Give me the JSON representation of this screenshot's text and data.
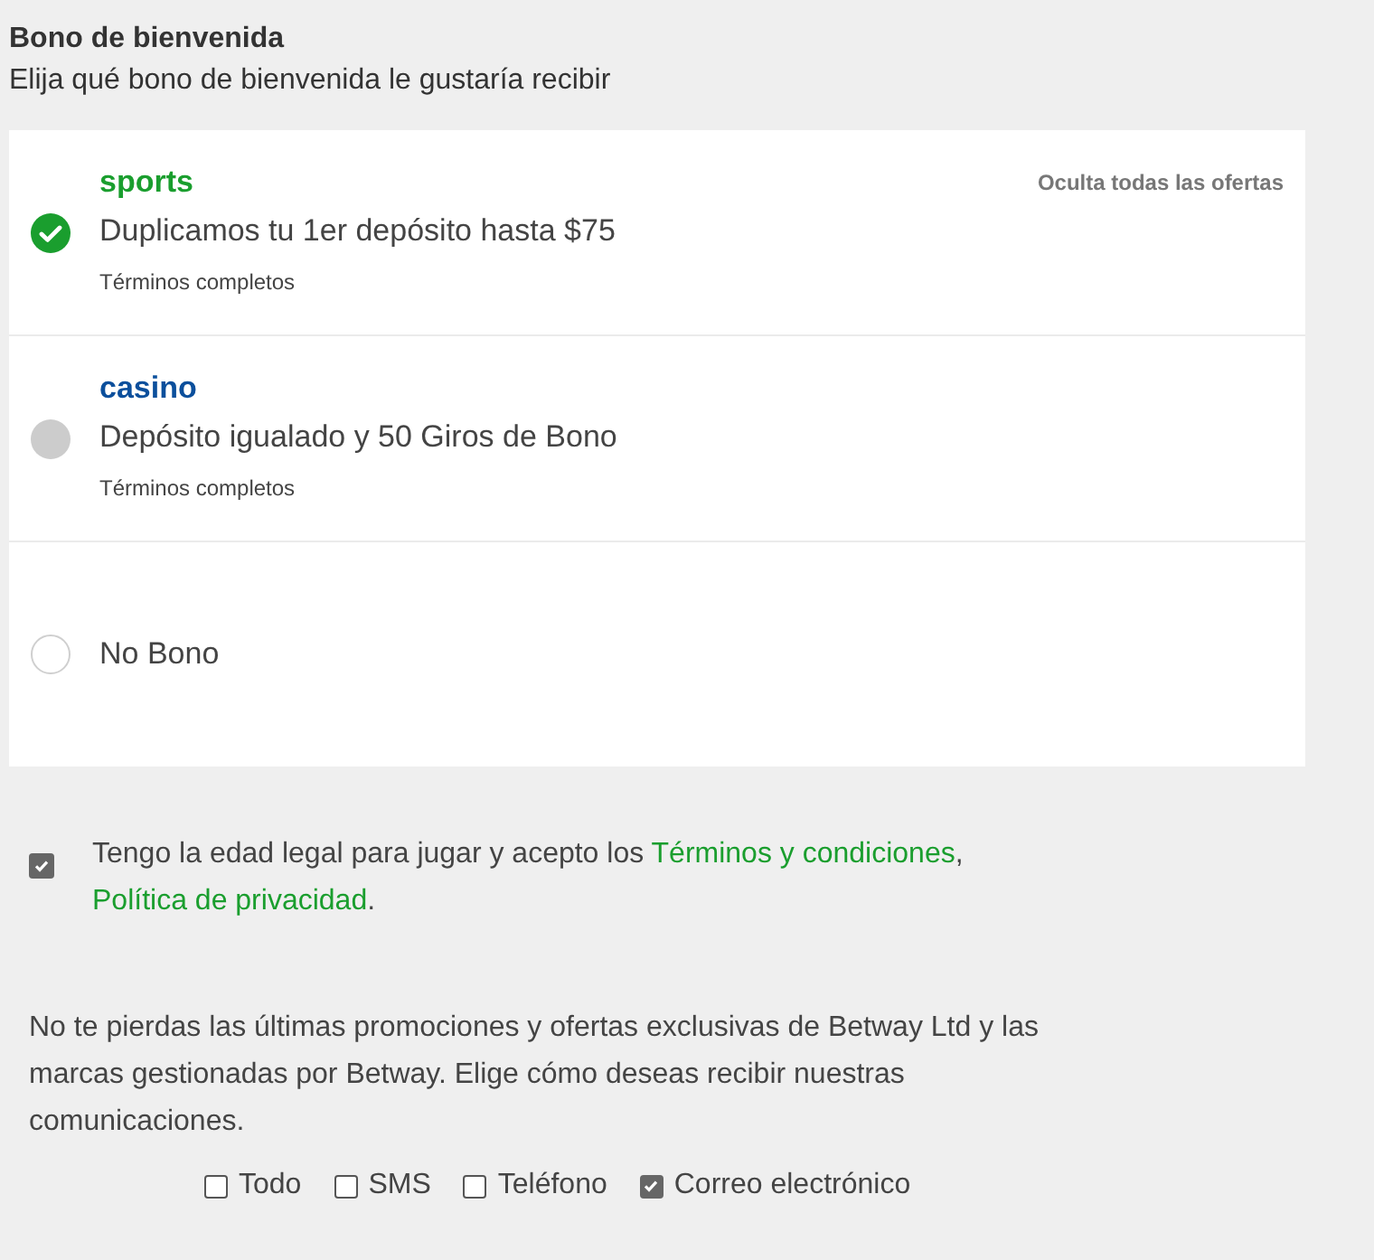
{
  "header": {
    "title": "Bono de bienvenida",
    "subtitle": "Elija qué bono de bienvenida le gustaría recibir"
  },
  "hide_offers": "Oculta todas las ofertas",
  "bonuses": [
    {
      "brand": "sports",
      "color": "#1a9e2e",
      "description": "Duplicamos tu 1er depósito hasta $75",
      "terms": "Términos completos",
      "selected": true,
      "disabled": false
    },
    {
      "brand": "casino",
      "color": "#0b4f9c",
      "description": "Depósito igualado y 50 Giros de Bono",
      "terms": "Términos completos",
      "selected": false,
      "disabled": true
    },
    {
      "description": "No Bono",
      "selected": false,
      "disabled": false
    }
  ],
  "consent": {
    "checked": true,
    "parts": [
      {
        "kind": "text",
        "text": "Tengo la edad legal para jugar y acepto los "
      },
      {
        "kind": "link",
        "text": "Términos y condiciones"
      },
      {
        "kind": "text",
        "text": ", "
      },
      {
        "kind": "link",
        "text": "Política de privacidad"
      },
      {
        "kind": "text",
        "text": "."
      }
    ]
  },
  "marketing": {
    "text": "No te pierdas las últimas promociones y ofertas exclusivas de Betway Ltd y las marcas gestionadas por Betway. Elige cómo deseas recibir nuestras comunicaciones.",
    "channels": [
      {
        "label": "Todo",
        "checked": false
      },
      {
        "label": "SMS",
        "checked": false
      },
      {
        "label": "Teléfono",
        "checked": false
      },
      {
        "label": "Correo electrónico",
        "checked": true
      }
    ]
  }
}
